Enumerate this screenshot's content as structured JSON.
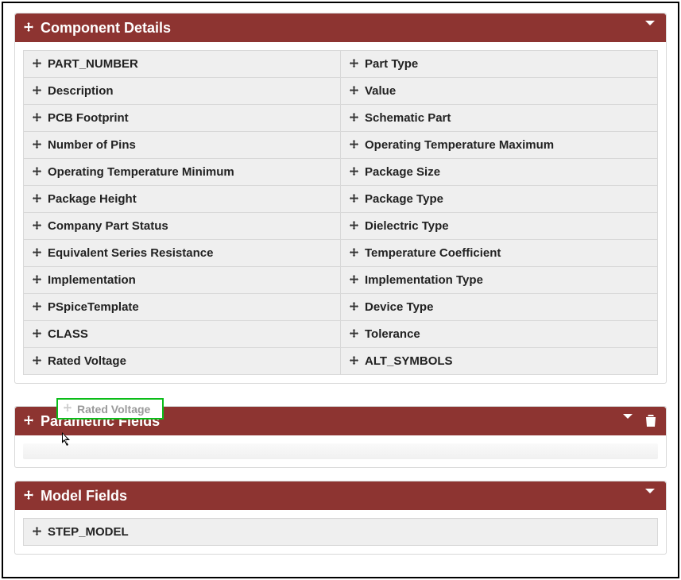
{
  "panels": {
    "componentDetails": {
      "title": "Component Details"
    },
    "parametricFields": {
      "title": "Parametric Fields"
    },
    "modelFields": {
      "title": "Model Fields"
    }
  },
  "componentDetails": {
    "rows": [
      {
        "l": "PART_NUMBER",
        "r": "Part Type"
      },
      {
        "l": "Description",
        "r": "Value"
      },
      {
        "l": "PCB Footprint",
        "r": "Schematic Part"
      },
      {
        "l": "Number of Pins",
        "r": "Operating Temperature Maximum"
      },
      {
        "l": "Operating Temperature Minimum",
        "r": "Package Size"
      },
      {
        "l": "Package Height",
        "r": "Package Type"
      },
      {
        "l": "Company Part Status",
        "r": "Dielectric Type"
      },
      {
        "l": "Equivalent Series Resistance",
        "r": "Temperature Coefficient"
      },
      {
        "l": "Implementation",
        "r": "Implementation Type"
      },
      {
        "l": "PSpiceTemplate",
        "r": "Device Type"
      },
      {
        "l": "CLASS",
        "r": "Tolerance"
      },
      {
        "l": "Rated Voltage",
        "r": "ALT_SYMBOLS"
      }
    ]
  },
  "drag": {
    "label": "Rated Voltage"
  },
  "modelFields": {
    "items": [
      "STEP_MODEL"
    ]
  },
  "colors": {
    "headerBg": "#8d3431",
    "ghostBorder": "#0bbd19"
  }
}
